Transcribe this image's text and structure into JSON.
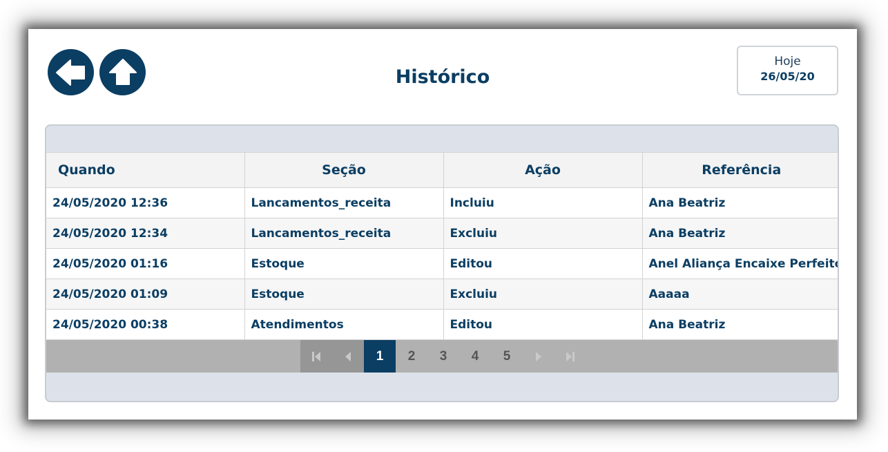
{
  "header": {
    "title": "Histórico",
    "back_icon": "arrow-left-icon",
    "home_icon": "arrow-up-icon",
    "today_label": "Hoje",
    "today_date": "26/05/20"
  },
  "table": {
    "columns": [
      "Quando",
      "Seção",
      "Ação",
      "Referência"
    ],
    "rows": [
      [
        "24/05/2020 12:36",
        "Lancamentos_receita",
        "Incluiu",
        "Ana Beatriz"
      ],
      [
        "24/05/2020 12:34",
        "Lancamentos_receita",
        "Excluiu",
        "Ana Beatriz"
      ],
      [
        "24/05/2020 01:16",
        "Estoque",
        "Editou",
        "Anel Aliança Encaixe Perfeito"
      ],
      [
        "24/05/2020 01:09",
        "Estoque",
        "Excluiu",
        "Aaaaa"
      ],
      [
        "24/05/2020 00:38",
        "Atendimentos",
        "Editou",
        "Ana Beatriz"
      ]
    ]
  },
  "pager": {
    "pages": [
      "1",
      "2",
      "3",
      "4",
      "5"
    ],
    "current": "1",
    "icons": [
      "first-page-icon",
      "prev-page-icon",
      "next-page-icon",
      "last-page-icon"
    ]
  },
  "colors": {
    "primary": "#0b3e63",
    "panel": "#dde2ea",
    "pager": "#b1b1b1"
  }
}
